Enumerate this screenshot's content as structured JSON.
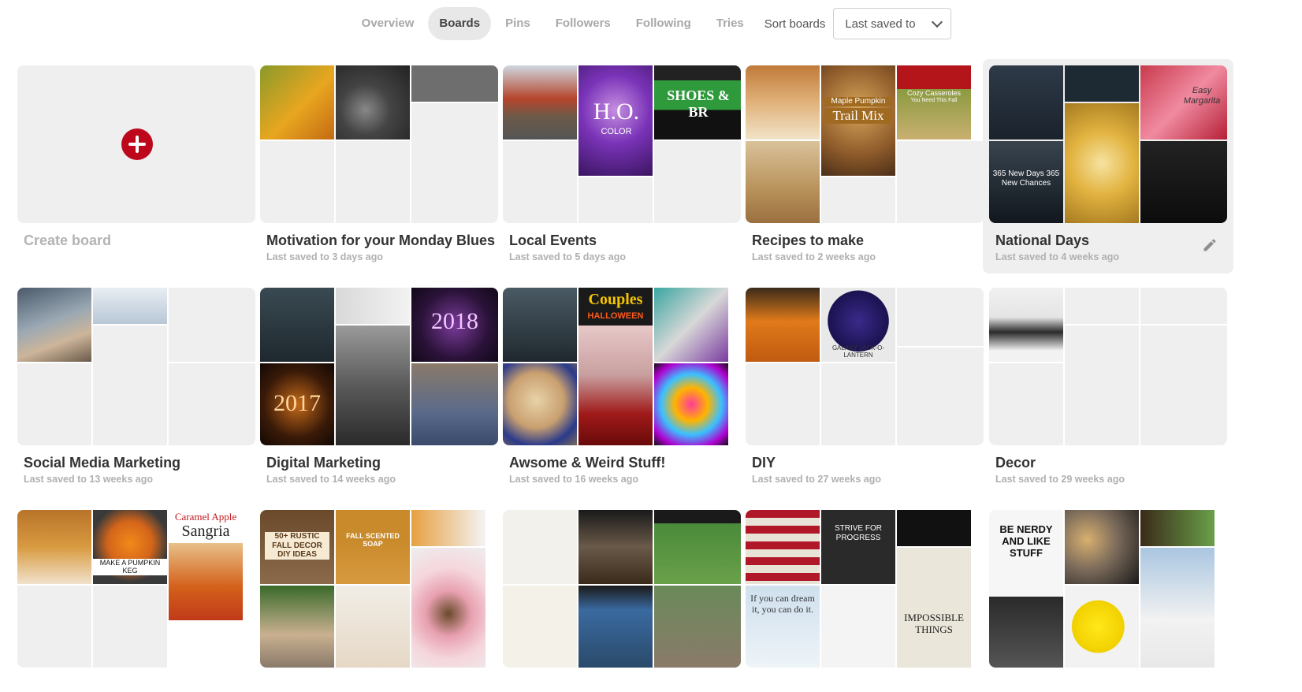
{
  "nav": {
    "tabs": [
      {
        "label": "Overview"
      },
      {
        "label": "Boards"
      },
      {
        "label": "Pins"
      },
      {
        "label": "Followers"
      },
      {
        "label": "Following"
      },
      {
        "label": "Tries"
      }
    ],
    "sort_label": "Sort boards",
    "sort_value": "Last saved to"
  },
  "create": {
    "label": "Create board"
  },
  "boards": [
    {
      "title": "Motivation for your Monday Blues",
      "subtitle": "Last saved to 3 days ago"
    },
    {
      "title": "Local Events",
      "subtitle": "Last saved to 5 days ago"
    },
    {
      "title": "Recipes to make",
      "subtitle": "Last saved to 2 weeks ago"
    },
    {
      "title": "National Days",
      "subtitle": "Last saved to 4 weeks ago"
    },
    {
      "title": "Social Media Marketing",
      "subtitle": "Last saved to 13 weeks ago"
    },
    {
      "title": "Digital Marketing",
      "subtitle": "Last saved to 14 weeks ago"
    },
    {
      "title": "Awsome & Weird Stuff!",
      "subtitle": "Last saved to 16 weeks ago"
    },
    {
      "title": "DIY",
      "subtitle": "Last saved to 27 weeks ago"
    },
    {
      "title": "Decor",
      "subtitle": "Last saved to 29 weeks ago"
    }
  ],
  "thumb_text": {
    "b3_main": "H.O.",
    "b3_sub": "COLOR",
    "b3_shoes": "SHOES & BR",
    "b4_trail": "Trail Mix",
    "b4_maple": "Maple Pumpkin",
    "b4_cozy": "Cozy Casseroles",
    "b4_need": "You Need This Fall",
    "b5_days": "365 New Days 365 New Chances",
    "b5_marg": "Easy Margarita",
    "b7_2018": "2018",
    "b7_2017": "2017",
    "b8_couples": "Couples",
    "b8_halloween": "HALLOWEEN",
    "b9_galaxy": "GALAXY JACK-O-LANTERN",
    "r3_sangria": "Sangria",
    "r3_caramel": "Caramel Apple",
    "r3_keg": "MAKE A PUMPKIN KEG",
    "r3_rustic": "50+ RUSTIC FALL DECOR DIY IDEAS",
    "r3_soap": "FALL SCENTED SOAP",
    "r3_strive": "STRIVE FOR PROGRESS",
    "r3_dream": "If you can dream it, you can do it.",
    "r3_nerdy": "BE NERDY AND LIKE STUFF",
    "r3_impossible": "IMPOSSIBLE THINGS"
  },
  "colors": {
    "accent": "#bd081c",
    "active_tab_bg": "#e8e8e8",
    "placeholder": "#efefef"
  }
}
